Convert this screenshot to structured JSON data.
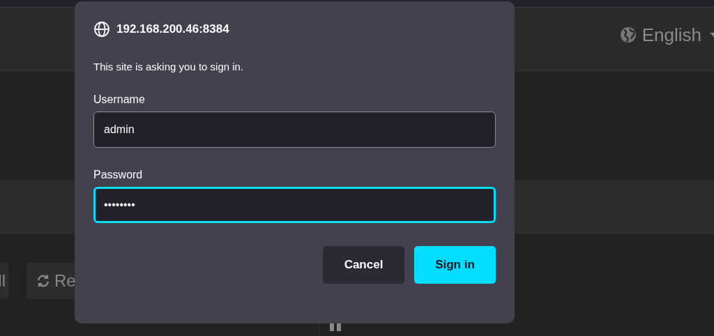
{
  "page": {
    "language": "English",
    "buttons": [
      {
        "label": "ll",
        "kind": "plain"
      },
      {
        "label": "Re",
        "kind": "refresh"
      }
    ]
  },
  "dialog": {
    "host": "192.168.200.46:8384",
    "message": "This site is asking you to sign in.",
    "fields": [
      {
        "label": "Username",
        "value": "admin",
        "focused": false
      },
      {
        "label": "Password",
        "value": "••••••••",
        "focused": true
      }
    ],
    "buttons": [
      {
        "label": "Cancel",
        "kind": "secondary"
      },
      {
        "label": "Sign in",
        "kind": "primary"
      }
    ]
  }
}
